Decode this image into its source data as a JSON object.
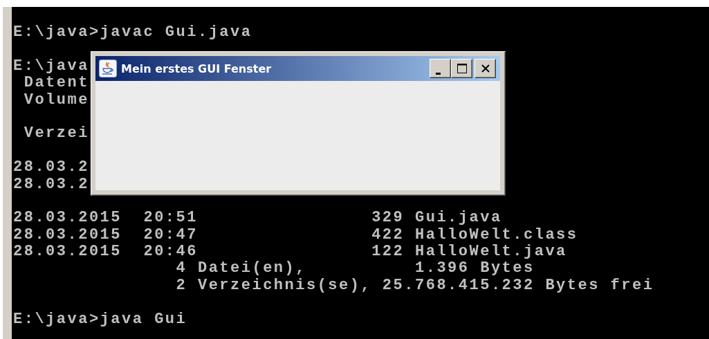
{
  "console": {
    "blocks": [
      [
        "E:\\java>javac Gui.java"
      ],
      [
        "E:\\java",
        " Datent",
        " Volume"
      ],
      [
        " Verzei"
      ],
      [
        "28.03.2",
        "28.03.2"
      ],
      [
        "28.03.2015  20:51                329 Gui.java",
        "28.03.2015  20:47                422 HalloWelt.class",
        "28.03.2015  20:46                122 HalloWelt.java",
        "               4 Datei(en),          1.396 Bytes",
        "               2 Verzeichnis(se), 25.768.415.232 Bytes frei"
      ],
      [
        "E:\\java>java Gui"
      ]
    ]
  },
  "window": {
    "title": "Mein erstes GUI Fenster"
  }
}
